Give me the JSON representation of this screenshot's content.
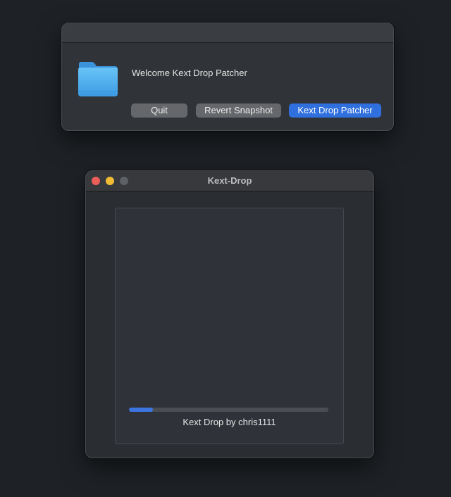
{
  "dialog": {
    "message": "Welcome Kext Drop Patcher",
    "buttons": {
      "quit": "Quit",
      "revert": "Revert Snapshot",
      "patch": "Kext Drop Patcher"
    }
  },
  "window": {
    "title": "Kext-Drop",
    "progress": 0.12,
    "credit": "Kext Drop by chris1111"
  },
  "icons": {
    "folder": "folder-icon",
    "close": "close-window-icon",
    "minimize": "minimize-window-icon",
    "zoom": "zoom-window-icon"
  },
  "colors": {
    "accent": "#2f6fde",
    "progress": "#3d75e0",
    "close": "#ec5f58",
    "minimize": "#f2bb35",
    "folder": "#5cb8f2"
  }
}
